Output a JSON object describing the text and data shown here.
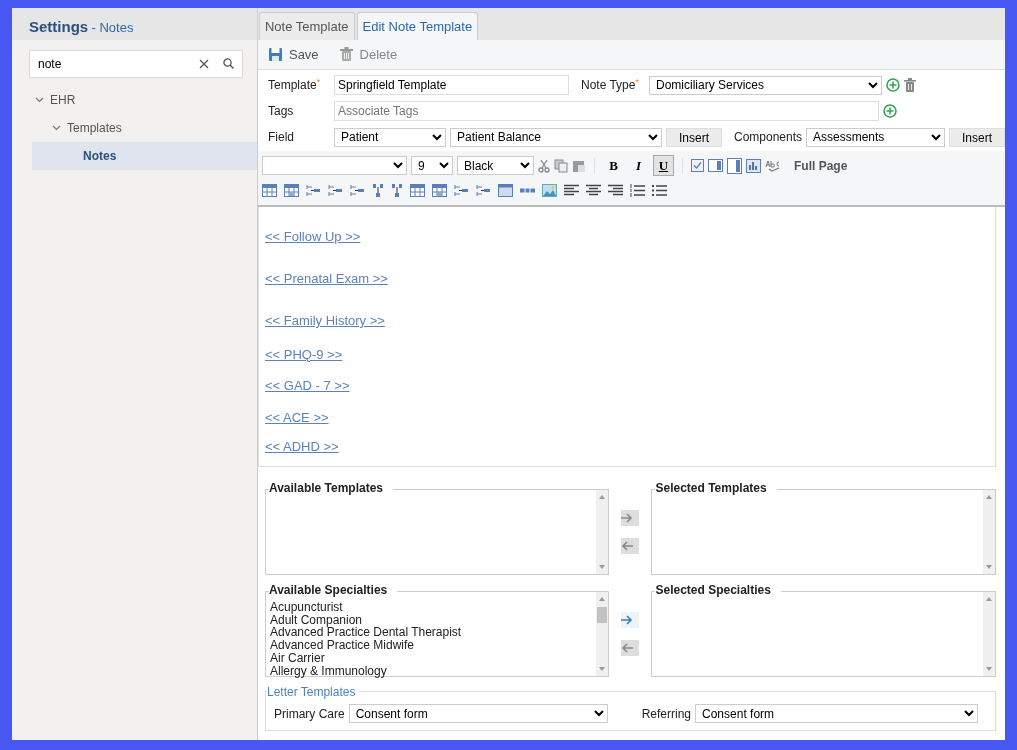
{
  "sidebar": {
    "title": "Settings",
    "subtitle": "- Notes",
    "search": {
      "value": "note"
    },
    "tree": [
      {
        "label": "EHR",
        "expanded": true,
        "selected": false,
        "children": [
          {
            "label": "Templates",
            "expanded": true,
            "selected": false,
            "children": [
              {
                "label": "Notes",
                "selected": true
              }
            ]
          }
        ]
      }
    ]
  },
  "tabs": [
    {
      "label": "Note Template",
      "selected": false
    },
    {
      "label": "Edit Note Template",
      "selected": true
    }
  ],
  "actions": [
    {
      "label": "Save",
      "kind": "save",
      "disabled": false
    },
    {
      "label": "Delete",
      "kind": "delete",
      "disabled": true
    }
  ],
  "form": {
    "template": {
      "label": "Template$^{*}$",
      "value": "Springfield Template"
    },
    "note_type": {
      "label": "Note Type$^{*}$",
      "value": "Domiciliary Services"
    },
    "tags": {
      "label": "Tags",
      "placeholder": "Associate Tags"
    },
    "field": {
      "label": "Field",
      "value": "Patient",
      "value_2": "Patient Balance",
      "button": "Insert"
    },
    "components": {
      "label": "Components",
      "value": "Assessments",
      "button": "Insert"
    }
  },
  "editor_toolbar": {
    "size": "9",
    "text_shade": "Black",
    "format_buttons": [
      {
        "label": "B",
        "kind": "bold",
        "on": false
      },
      {
        "label": "I",
        "kind": "italic",
        "on": false
      },
      {
        "label": "U",
        "kind": "underline",
        "on": true
      }
    ],
    "full_page": "Full Page"
  },
  "editor_links": [
    "<< Follow Up >>",
    "<< Prenatal Exam >>",
    "<< Family History >>",
    "<< PHQ-9 >>",
    "<< GAD - 7 >>",
    "<< ACE >>",
    "<< ADHD >>"
  ],
  "transfers": [
    {
      "available": "Available Templates",
      "selected": "Selected Templates",
      "add_enabled": false,
      "remove_enabled": false
    },
    {
      "available": "Available Specialties",
      "selected": "Selected Specialties",
      "add_enabled": true,
      "remove_enabled": false,
      "items": [
        "Acupuncturist",
        "Adult Companion",
        "Advanced Practice Dental Therapist",
        "Advanced Practice Midwife",
        "Air Carrier",
        "Allergy & Immunology"
      ]
    }
  ],
  "letter_templates": {
    "title": "Letter Templates",
    "primary_care": {
      "label": "Primary Care",
      "value": "Consent form"
    },
    "referring": {
      "label": "Referring",
      "value": "Consent form"
    }
  }
}
